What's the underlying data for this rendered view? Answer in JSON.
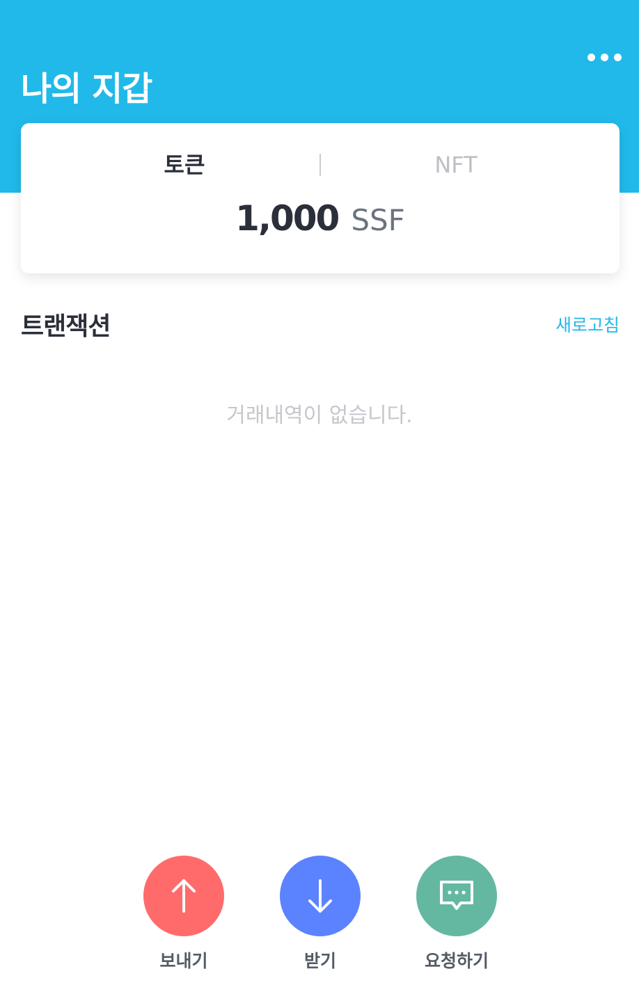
{
  "header": {
    "title": "나의 지갑",
    "more_icon": "more-horizontal-icon",
    "background_color": "#21b9e9"
  },
  "balance_card": {
    "tabs": [
      {
        "label": "토큰",
        "active": true
      },
      {
        "label": "NFT",
        "active": false
      }
    ],
    "amount": "1,000",
    "unit": "SSF"
  },
  "transactions": {
    "title": "트랜잭션",
    "refresh_label": "새로고침",
    "empty_message": "거래내역이 없습니다."
  },
  "actions": [
    {
      "label": "보내기",
      "icon": "arrow-up-icon",
      "color": "#ff6b6b"
    },
    {
      "label": "받기",
      "icon": "arrow-down-icon",
      "color": "#5b82ff"
    },
    {
      "label": "요청하기",
      "icon": "chat-request-icon",
      "color": "#64b8a1"
    }
  ]
}
